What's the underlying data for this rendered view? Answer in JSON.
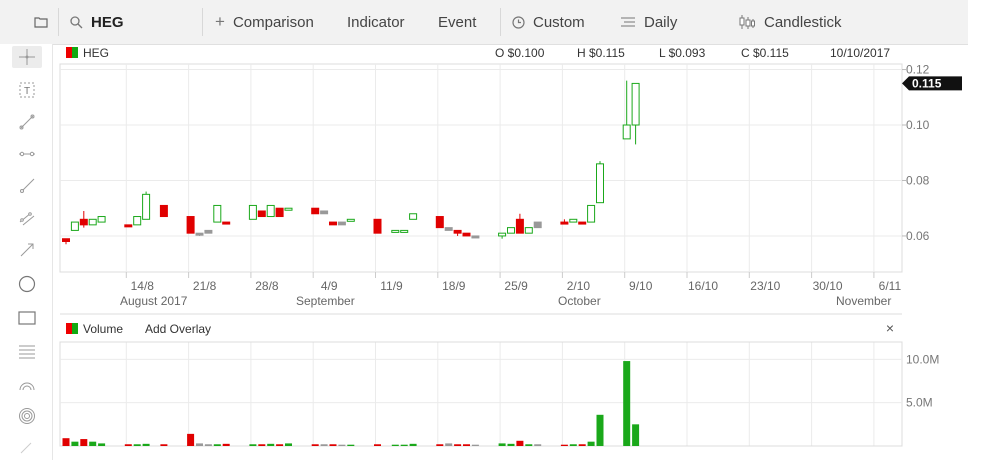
{
  "topbar": {
    "symbol": "HEG",
    "comparison": "Comparison",
    "indicator": "Indicator",
    "event": "Event",
    "custom": "Custom",
    "period": "Daily",
    "chart_type": "Candlestick",
    "icons": [
      "window-icon",
      "search-icon",
      "plus-icon",
      "clock-icon",
      "bars-icon",
      "candlestick-icon"
    ]
  },
  "left_tools": [
    "crosshair-icon",
    "text-box-icon",
    "line-segment-icon",
    "horizontal-line-icon",
    "ray-icon",
    "parallel-channel-icon",
    "arrow-icon",
    "circle-icon",
    "rectangle-icon",
    "fib-lines-icon",
    "arc-icon",
    "target-icon",
    "more-icon"
  ],
  "price_header": {
    "symbol": "HEG",
    "open": "O $0.100",
    "high": "H $0.115",
    "low": "L $0.093",
    "close": "C $0.115",
    "date": "10/10/2017",
    "last_price": "0.115"
  },
  "volume_header": {
    "label": "Volume",
    "overlay": "Add Overlay",
    "close": "×"
  },
  "colors": {
    "up": "#1aa81a",
    "down": "#e00000",
    "neutral": "#999999",
    "grid": "#ebebeb"
  },
  "chart_data": [
    {
      "type": "candlestick",
      "title": "HEG",
      "y_ticks": [
        "0.12",
        "0.10",
        "0.08",
        "0.06"
      ],
      "x_ticks": [
        "14/8",
        "21/8",
        "28/8",
        "4/9",
        "11/9",
        "18/9",
        "25/9",
        "2/10",
        "9/10",
        "16/10",
        "23/10",
        "30/10",
        "6/11"
      ],
      "x_month_labels": [
        "August 2017",
        "September",
        "October",
        "November"
      ],
      "ylim": [
        0.047,
        0.122
      ],
      "candles": [
        {
          "date": "2017-08-07",
          "o": 0.059,
          "h": 0.059,
          "l": 0.057,
          "c": 0.058,
          "d": "down"
        },
        {
          "date": "2017-08-08",
          "o": 0.062,
          "h": 0.065,
          "l": 0.062,
          "c": 0.065,
          "d": "up"
        },
        {
          "date": "2017-08-09",
          "o": 0.066,
          "h": 0.069,
          "l": 0.063,
          "c": 0.064,
          "d": "down"
        },
        {
          "date": "2017-08-10",
          "o": 0.064,
          "h": 0.066,
          "l": 0.064,
          "c": 0.066,
          "d": "up"
        },
        {
          "date": "2017-08-11",
          "o": 0.065,
          "h": 0.067,
          "l": 0.065,
          "c": 0.067,
          "d": "up"
        },
        {
          "date": "2017-08-14",
          "o": 0.064,
          "h": 0.064,
          "l": 0.064,
          "c": 0.064,
          "d": "down"
        },
        {
          "date": "2017-08-15",
          "o": 0.064,
          "h": 0.067,
          "l": 0.064,
          "c": 0.067,
          "d": "up"
        },
        {
          "date": "2017-08-16",
          "o": 0.066,
          "h": 0.076,
          "l": 0.066,
          "c": 0.075,
          "d": "up"
        },
        {
          "date": "2017-08-18",
          "o": 0.071,
          "h": 0.071,
          "l": 0.067,
          "c": 0.067,
          "d": "down"
        },
        {
          "date": "2017-08-21",
          "o": 0.067,
          "h": 0.067,
          "l": 0.061,
          "c": 0.061,
          "d": "down"
        },
        {
          "date": "2017-08-22",
          "o": 0.061,
          "h": 0.061,
          "l": 0.06,
          "c": 0.061,
          "d": "neutral"
        },
        {
          "date": "2017-08-23",
          "o": 0.061,
          "h": 0.062,
          "l": 0.061,
          "c": 0.062,
          "d": "neutral"
        },
        {
          "date": "2017-08-24",
          "o": 0.065,
          "h": 0.071,
          "l": 0.065,
          "c": 0.071,
          "d": "up"
        },
        {
          "date": "2017-08-25",
          "o": 0.065,
          "h": 0.065,
          "l": 0.065,
          "c": 0.065,
          "d": "down"
        },
        {
          "date": "2017-08-28",
          "o": 0.066,
          "h": 0.071,
          "l": 0.066,
          "c": 0.071,
          "d": "up"
        },
        {
          "date": "2017-08-29",
          "o": 0.069,
          "h": 0.069,
          "l": 0.067,
          "c": 0.067,
          "d": "down"
        },
        {
          "date": "2017-08-30",
          "o": 0.067,
          "h": 0.071,
          "l": 0.067,
          "c": 0.071,
          "d": "up"
        },
        {
          "date": "2017-08-31",
          "o": 0.07,
          "h": 0.07,
          "l": 0.067,
          "c": 0.067,
          "d": "down"
        },
        {
          "date": "2017-09-01",
          "o": 0.07,
          "h": 0.07,
          "l": 0.07,
          "c": 0.07,
          "d": "up"
        },
        {
          "date": "2017-09-04",
          "o": 0.07,
          "h": 0.07,
          "l": 0.068,
          "c": 0.068,
          "d": "down"
        },
        {
          "date": "2017-09-05",
          "o": 0.069,
          "h": 0.069,
          "l": 0.068,
          "c": 0.068,
          "d": "neutral"
        },
        {
          "date": "2017-09-06",
          "o": 0.065,
          "h": 0.065,
          "l": 0.064,
          "c": 0.064,
          "d": "down"
        },
        {
          "date": "2017-09-07",
          "o": 0.065,
          "h": 0.065,
          "l": 0.064,
          "c": 0.064,
          "d": "neutral"
        },
        {
          "date": "2017-09-08",
          "o": 0.066,
          "h": 0.066,
          "l": 0.066,
          "c": 0.066,
          "d": "up"
        },
        {
          "date": "2017-09-11",
          "o": 0.066,
          "h": 0.066,
          "l": 0.061,
          "c": 0.061,
          "d": "down"
        },
        {
          "date": "2017-09-13",
          "o": 0.062,
          "h": 0.062,
          "l": 0.062,
          "c": 0.062,
          "d": "up"
        },
        {
          "date": "2017-09-14",
          "o": 0.062,
          "h": 0.062,
          "l": 0.062,
          "c": 0.062,
          "d": "up"
        },
        {
          "date": "2017-09-15",
          "o": 0.066,
          "h": 0.068,
          "l": 0.066,
          "c": 0.068,
          "d": "up"
        },
        {
          "date": "2017-09-18",
          "o": 0.067,
          "h": 0.067,
          "l": 0.063,
          "c": 0.063,
          "d": "down"
        },
        {
          "date": "2017-09-19",
          "o": 0.063,
          "h": 0.063,
          "l": 0.062,
          "c": 0.062,
          "d": "neutral"
        },
        {
          "date": "2017-09-20",
          "o": 0.062,
          "h": 0.062,
          "l": 0.06,
          "c": 0.061,
          "d": "down"
        },
        {
          "date": "2017-09-21",
          "o": 0.061,
          "h": 0.061,
          "l": 0.06,
          "c": 0.06,
          "d": "down"
        },
        {
          "date": "2017-09-22",
          "o": 0.06,
          "h": 0.06,
          "l": 0.06,
          "c": 0.06,
          "d": "neutral"
        },
        {
          "date": "2017-09-25",
          "o": 0.06,
          "h": 0.061,
          "l": 0.059,
          "c": 0.061,
          "d": "up"
        },
        {
          "date": "2017-09-26",
          "o": 0.061,
          "h": 0.063,
          "l": 0.061,
          "c": 0.063,
          "d": "up"
        },
        {
          "date": "2017-09-27",
          "o": 0.066,
          "h": 0.068,
          "l": 0.061,
          "c": 0.061,
          "d": "down"
        },
        {
          "date": "2017-09-28",
          "o": 0.061,
          "h": 0.063,
          "l": 0.061,
          "c": 0.063,
          "d": "up"
        },
        {
          "date": "2017-09-29",
          "o": 0.063,
          "h": 0.065,
          "l": 0.063,
          "c": 0.065,
          "d": "neutral"
        },
        {
          "date": "2017-10-02",
          "o": 0.065,
          "h": 0.066,
          "l": 0.065,
          "c": 0.065,
          "d": "down"
        },
        {
          "date": "2017-10-03",
          "o": 0.065,
          "h": 0.066,
          "l": 0.065,
          "c": 0.066,
          "d": "up"
        },
        {
          "date": "2017-10-04",
          "o": 0.065,
          "h": 0.065,
          "l": 0.065,
          "c": 0.065,
          "d": "down"
        },
        {
          "date": "2017-10-05",
          "o": 0.065,
          "h": 0.071,
          "l": 0.065,
          "c": 0.071,
          "d": "up"
        },
        {
          "date": "2017-10-06",
          "o": 0.072,
          "h": 0.087,
          "l": 0.072,
          "c": 0.086,
          "d": "up"
        },
        {
          "date": "2017-10-09",
          "o": 0.095,
          "h": 0.116,
          "l": 0.095,
          "c": 0.1,
          "d": "up"
        },
        {
          "date": "2017-10-10",
          "o": 0.1,
          "h": 0.115,
          "l": 0.093,
          "c": 0.115,
          "d": "up"
        }
      ]
    },
    {
      "type": "bar",
      "title": "Volume",
      "y_ticks": [
        "10.0M",
        "5.0M"
      ],
      "ylim": [
        0,
        12.0
      ],
      "unit": "M",
      "bars": [
        {
          "v": 0.9,
          "d": "down"
        },
        {
          "v": 0.5,
          "d": "up"
        },
        {
          "v": 0.8,
          "d": "down"
        },
        {
          "v": 0.5,
          "d": "up"
        },
        {
          "v": 0.3,
          "d": "up"
        },
        {
          "v": 0.2,
          "d": "down"
        },
        {
          "v": 0.2,
          "d": "up"
        },
        {
          "v": 0.25,
          "d": "up"
        },
        {
          "v": 0.2,
          "d": "down"
        },
        {
          "v": 1.4,
          "d": "down"
        },
        {
          "v": 0.3,
          "d": "neutral"
        },
        {
          "v": 0.2,
          "d": "neutral"
        },
        {
          "v": 0.2,
          "d": "up"
        },
        {
          "v": 0.25,
          "d": "down"
        },
        {
          "v": 0.2,
          "d": "up"
        },
        {
          "v": 0.2,
          "d": "down"
        },
        {
          "v": 0.25,
          "d": "up"
        },
        {
          "v": 0.2,
          "d": "down"
        },
        {
          "v": 0.3,
          "d": "up"
        },
        {
          "v": 0.2,
          "d": "down"
        },
        {
          "v": 0.2,
          "d": "neutral"
        },
        {
          "v": 0.2,
          "d": "down"
        },
        {
          "v": 0.15,
          "d": "neutral"
        },
        {
          "v": 0.15,
          "d": "up"
        },
        {
          "v": 0.2,
          "d": "down"
        },
        {
          "v": 0.15,
          "d": "up"
        },
        {
          "v": 0.15,
          "d": "up"
        },
        {
          "v": 0.25,
          "d": "up"
        },
        {
          "v": 0.2,
          "d": "down"
        },
        {
          "v": 0.3,
          "d": "neutral"
        },
        {
          "v": 0.2,
          "d": "down"
        },
        {
          "v": 0.2,
          "d": "down"
        },
        {
          "v": 0.15,
          "d": "neutral"
        },
        {
          "v": 0.3,
          "d": "up"
        },
        {
          "v": 0.25,
          "d": "up"
        },
        {
          "v": 0.6,
          "d": "down"
        },
        {
          "v": 0.2,
          "d": "up"
        },
        {
          "v": 0.2,
          "d": "neutral"
        },
        {
          "v": 0.15,
          "d": "down"
        },
        {
          "v": 0.2,
          "d": "up"
        },
        {
          "v": 0.2,
          "d": "down"
        },
        {
          "v": 0.5,
          "d": "up"
        },
        {
          "v": 3.6,
          "d": "up"
        },
        {
          "v": 9.8,
          "d": "up"
        },
        {
          "v": 2.5,
          "d": "up"
        }
      ]
    }
  ]
}
